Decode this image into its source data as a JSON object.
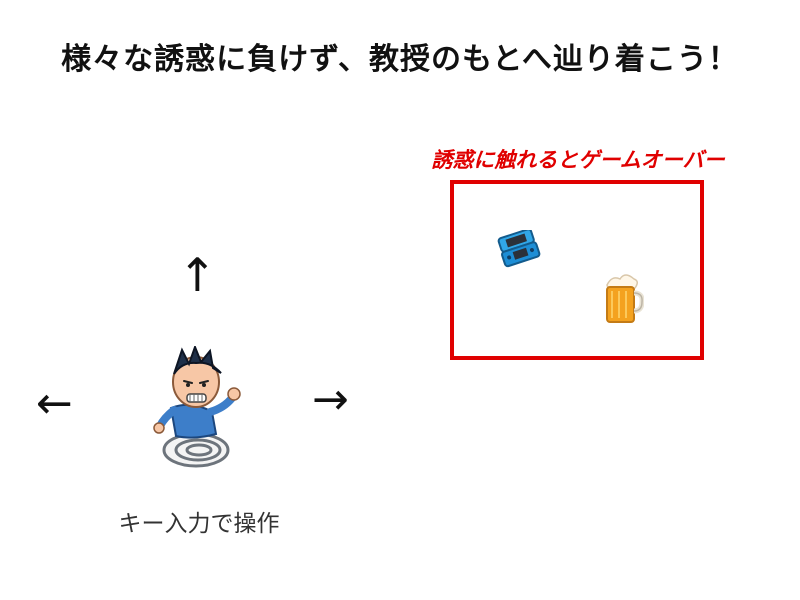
{
  "header": {
    "title": "様々な誘惑に負けず、教授のもとへ辿り着こう！"
  },
  "controls": {
    "up_symbol": "↑",
    "left_symbol": "←",
    "right_symbol": "→",
    "caption": "キー入力で操作"
  },
  "danger_zone": {
    "warning": "誘惑に触れるとゲームオーバー",
    "border_color": "#e00000",
    "temptations": [
      {
        "icon": "handheld-game-console-icon"
      },
      {
        "icon": "beer-mug-icon"
      }
    ]
  },
  "player": {
    "icon": "running-student-icon"
  }
}
